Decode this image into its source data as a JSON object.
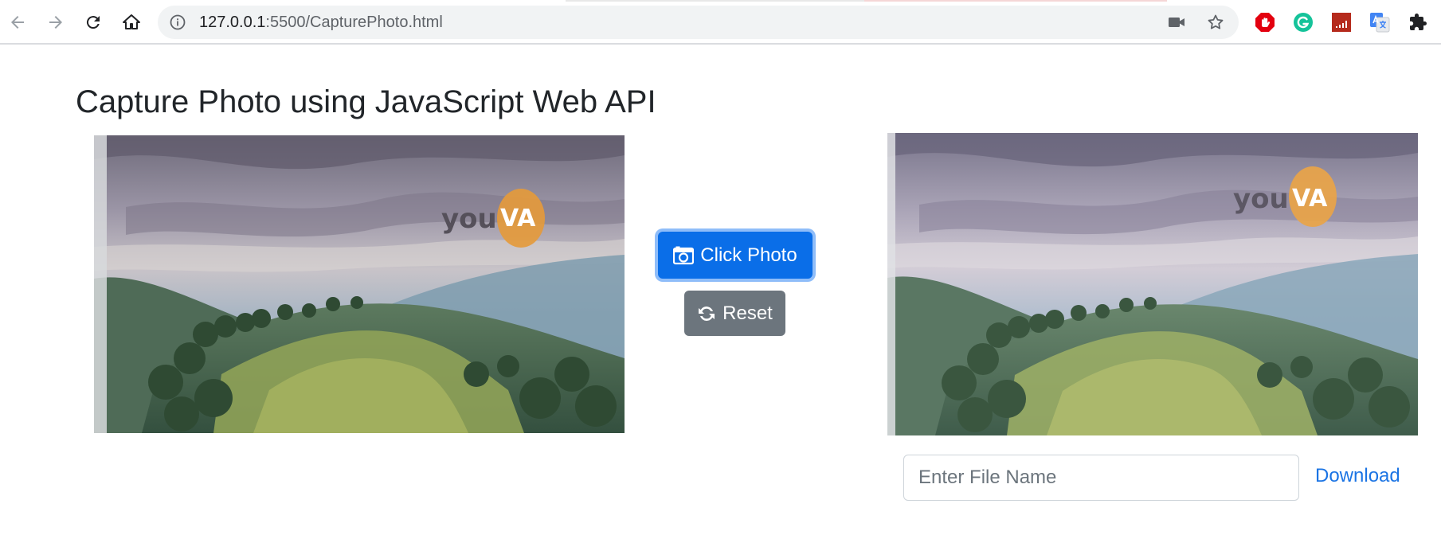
{
  "browser": {
    "url_host": "127.0.0.1",
    "url_path": ":5500/CapturePhoto.html"
  },
  "page": {
    "title": "Capture Photo using JavaScript Web API"
  },
  "controls": {
    "capture_label": "Click Photo",
    "reset_label": "Reset",
    "filename_placeholder": "Enter File Name",
    "download_label": "Download"
  },
  "photo": {
    "logo_text": "you",
    "logo_badge": "VA"
  },
  "colors": {
    "primary": "#0a6ee8",
    "secondary": "#6c757d",
    "link": "#1b74e4",
    "badge": "#e49a3c"
  },
  "icons": {
    "back": "arrow-left-icon",
    "forward": "arrow-right-icon",
    "reload": "reload-icon",
    "home": "home-icon",
    "site_info": "info-icon",
    "camera": "camera-icon",
    "bookmark": "star-icon",
    "capture": "camera-icon",
    "reset": "sync-icon",
    "extensions": "puzzle-icon"
  }
}
